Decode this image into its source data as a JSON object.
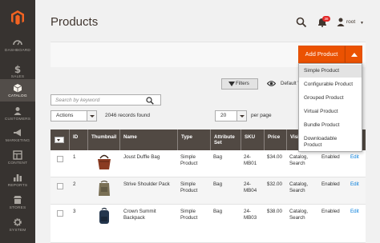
{
  "sidebar": {
    "logo": "magento-logo",
    "items": [
      {
        "label": "DASHBOARD",
        "icon": "speedometer-icon",
        "active": false
      },
      {
        "label": "SALES",
        "icon": "dollar-icon",
        "active": false
      },
      {
        "label": "CATALOG",
        "icon": "cube-icon",
        "active": true
      },
      {
        "label": "CUSTOMERS",
        "icon": "users-icon",
        "active": false
      },
      {
        "label": "MARKETING",
        "icon": "megaphone-icon",
        "active": false
      },
      {
        "label": "CONTENT",
        "icon": "layout-icon",
        "active": false
      },
      {
        "label": "REPORTS",
        "icon": "bar-chart-icon",
        "active": false
      },
      {
        "label": "STORES",
        "icon": "store-icon",
        "active": false
      },
      {
        "label": "SYSTEM",
        "icon": "gear-icon",
        "active": false
      }
    ]
  },
  "header": {
    "title": "Products",
    "notification_count": "38",
    "username": "root"
  },
  "toolbar": {
    "add_product_label": "Add Product",
    "filters_label": "Filters",
    "view_label": "Default V"
  },
  "add_menu": {
    "items": [
      "Simple Product",
      "Configurable Product",
      "Grouped Product",
      "Virtual Product",
      "Bundle Product",
      "Downloadable Product"
    ]
  },
  "search": {
    "placeholder": "Search by keyword"
  },
  "grid": {
    "actions_label": "Actions",
    "records_found": "2046 records found",
    "per_page_value": "20",
    "per_page_label": "per page",
    "columns": [
      "ID",
      "Thumbnail",
      "Name",
      "Type",
      "Attribute Set",
      "SKU",
      "Price",
      "Visi"
    ],
    "rows": [
      {
        "id": "1",
        "name": "Joust Duffle Bag",
        "type": "Simple Product",
        "attribute_set": "Bag",
        "sku": "24-MB01",
        "price": "$34.00",
        "visibility": "Catalog, Search",
        "status": "Enabled",
        "action": "Edit",
        "thumb": "duffle-bag"
      },
      {
        "id": "2",
        "name": "Strive Shoulder Pack",
        "type": "Simple Product",
        "attribute_set": "Bag",
        "sku": "24-MB04",
        "price": "$32.00",
        "visibility": "Catalog, Search",
        "status": "Enabled",
        "action": "Edit",
        "thumb": "shoulder-pack"
      },
      {
        "id": "3",
        "name": "Crown Summit Backpack",
        "type": "Simple Product",
        "attribute_set": "Bag",
        "sku": "24-MB03",
        "price": "$38.00",
        "visibility": "Catalog, Search",
        "status": "Enabled",
        "action": "Edit",
        "thumb": "backpack"
      }
    ]
  },
  "colors": {
    "sidebar_bg": "#373330",
    "accent": "#eb5202",
    "grid_header": "#514943",
    "link": "#007bdb",
    "badge": "#e22626"
  }
}
